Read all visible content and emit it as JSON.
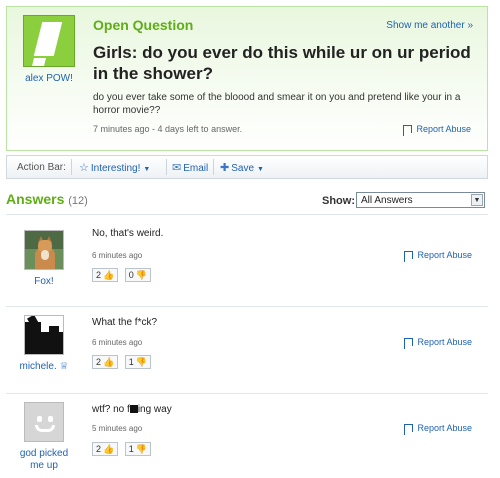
{
  "question": {
    "type_label": "Open Question",
    "show_another": "Show me another »",
    "title": "Girls: do you ever do this while ur on ur period in the shower?",
    "body": "do you ever take some of the bloood and smear it on you and pretend like your in a horror movie??",
    "meta": "7 minutes ago - 4 days left to answer.",
    "report": "Report Abuse",
    "asker_name": "alex POW!"
  },
  "action_bar": {
    "label": "Action Bar:",
    "interesting": "Interesting!",
    "email": "Email",
    "save": "Save"
  },
  "answers_header": {
    "title": "Answers",
    "count": "(12)",
    "show_label": "Show:",
    "show_value": "All Answers"
  },
  "answers": [
    {
      "user": "Fox!",
      "text": "No, that's weird.",
      "time": "6 minutes ago",
      "up": "2",
      "down": "0",
      "report": "Report Abuse"
    },
    {
      "user": "michele.",
      "text": "What the f*ck?",
      "time": "6 minutes ago",
      "up": "2",
      "down": "1",
      "report": "Report Abuse"
    },
    {
      "user": "god picked me up",
      "text_pre": "wtf? no f",
      "text_post": "ing way",
      "time": "5 minutes ago",
      "up": "2",
      "down": "1",
      "report": "Report Abuse"
    }
  ],
  "icons": {
    "asker_avatar": "green-exclamation-avatar-icon",
    "interesting": "star-icon",
    "email": "envelope-icon",
    "save": "plus-icon",
    "report": "flag-icon",
    "thumb_up": "thumbs-up-icon",
    "thumb_down": "thumbs-down-icon",
    "top_contributor": "crown-icon"
  },
  "colors": {
    "accent_green": "#5fae17",
    "link_blue": "#1f62b3"
  }
}
